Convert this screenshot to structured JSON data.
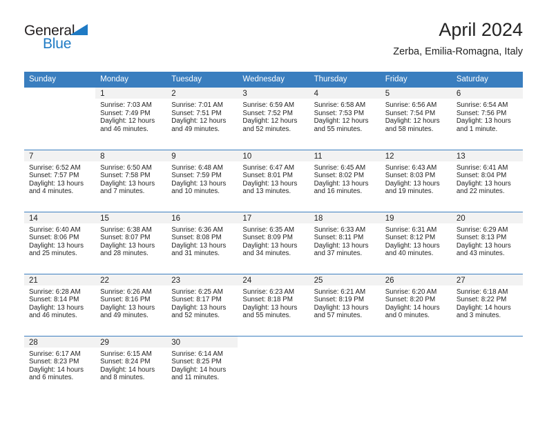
{
  "brand": {
    "name_top": "General",
    "name_bottom": "Blue",
    "triangle_icon": "triangle-icon",
    "accent_color": "#1e7ac4"
  },
  "header": {
    "title": "April 2024",
    "subtitle": "Zerba, Emilia-Romagna, Italy"
  },
  "calendar": {
    "header_bg": "#3a7ebf",
    "datebar_bg": "#f2f2f2",
    "weekday_headers": [
      "Sunday",
      "Monday",
      "Tuesday",
      "Wednesday",
      "Thursday",
      "Friday",
      "Saturday"
    ],
    "weeks": [
      [
        {
          "date": "",
          "lines": []
        },
        {
          "date": "1",
          "lines": [
            "Sunrise: 7:03 AM",
            "Sunset: 7:49 PM",
            "Daylight: 12 hours",
            "and 46 minutes."
          ]
        },
        {
          "date": "2",
          "lines": [
            "Sunrise: 7:01 AM",
            "Sunset: 7:51 PM",
            "Daylight: 12 hours",
            "and 49 minutes."
          ]
        },
        {
          "date": "3",
          "lines": [
            "Sunrise: 6:59 AM",
            "Sunset: 7:52 PM",
            "Daylight: 12 hours",
            "and 52 minutes."
          ]
        },
        {
          "date": "4",
          "lines": [
            "Sunrise: 6:58 AM",
            "Sunset: 7:53 PM",
            "Daylight: 12 hours",
            "and 55 minutes."
          ]
        },
        {
          "date": "5",
          "lines": [
            "Sunrise: 6:56 AM",
            "Sunset: 7:54 PM",
            "Daylight: 12 hours",
            "and 58 minutes."
          ]
        },
        {
          "date": "6",
          "lines": [
            "Sunrise: 6:54 AM",
            "Sunset: 7:56 PM",
            "Daylight: 13 hours",
            "and 1 minute."
          ]
        }
      ],
      [
        {
          "date": "7",
          "lines": [
            "Sunrise: 6:52 AM",
            "Sunset: 7:57 PM",
            "Daylight: 13 hours",
            "and 4 minutes."
          ]
        },
        {
          "date": "8",
          "lines": [
            "Sunrise: 6:50 AM",
            "Sunset: 7:58 PM",
            "Daylight: 13 hours",
            "and 7 minutes."
          ]
        },
        {
          "date": "9",
          "lines": [
            "Sunrise: 6:48 AM",
            "Sunset: 7:59 PM",
            "Daylight: 13 hours",
            "and 10 minutes."
          ]
        },
        {
          "date": "10",
          "lines": [
            "Sunrise: 6:47 AM",
            "Sunset: 8:01 PM",
            "Daylight: 13 hours",
            "and 13 minutes."
          ]
        },
        {
          "date": "11",
          "lines": [
            "Sunrise: 6:45 AM",
            "Sunset: 8:02 PM",
            "Daylight: 13 hours",
            "and 16 minutes."
          ]
        },
        {
          "date": "12",
          "lines": [
            "Sunrise: 6:43 AM",
            "Sunset: 8:03 PM",
            "Daylight: 13 hours",
            "and 19 minutes."
          ]
        },
        {
          "date": "13",
          "lines": [
            "Sunrise: 6:41 AM",
            "Sunset: 8:04 PM",
            "Daylight: 13 hours",
            "and 22 minutes."
          ]
        }
      ],
      [
        {
          "date": "14",
          "lines": [
            "Sunrise: 6:40 AM",
            "Sunset: 8:06 PM",
            "Daylight: 13 hours",
            "and 25 minutes."
          ]
        },
        {
          "date": "15",
          "lines": [
            "Sunrise: 6:38 AM",
            "Sunset: 8:07 PM",
            "Daylight: 13 hours",
            "and 28 minutes."
          ]
        },
        {
          "date": "16",
          "lines": [
            "Sunrise: 6:36 AM",
            "Sunset: 8:08 PM",
            "Daylight: 13 hours",
            "and 31 minutes."
          ]
        },
        {
          "date": "17",
          "lines": [
            "Sunrise: 6:35 AM",
            "Sunset: 8:09 PM",
            "Daylight: 13 hours",
            "and 34 minutes."
          ]
        },
        {
          "date": "18",
          "lines": [
            "Sunrise: 6:33 AM",
            "Sunset: 8:11 PM",
            "Daylight: 13 hours",
            "and 37 minutes."
          ]
        },
        {
          "date": "19",
          "lines": [
            "Sunrise: 6:31 AM",
            "Sunset: 8:12 PM",
            "Daylight: 13 hours",
            "and 40 minutes."
          ]
        },
        {
          "date": "20",
          "lines": [
            "Sunrise: 6:29 AM",
            "Sunset: 8:13 PM",
            "Daylight: 13 hours",
            "and 43 minutes."
          ]
        }
      ],
      [
        {
          "date": "21",
          "lines": [
            "Sunrise: 6:28 AM",
            "Sunset: 8:14 PM",
            "Daylight: 13 hours",
            "and 46 minutes."
          ]
        },
        {
          "date": "22",
          "lines": [
            "Sunrise: 6:26 AM",
            "Sunset: 8:16 PM",
            "Daylight: 13 hours",
            "and 49 minutes."
          ]
        },
        {
          "date": "23",
          "lines": [
            "Sunrise: 6:25 AM",
            "Sunset: 8:17 PM",
            "Daylight: 13 hours",
            "and 52 minutes."
          ]
        },
        {
          "date": "24",
          "lines": [
            "Sunrise: 6:23 AM",
            "Sunset: 8:18 PM",
            "Daylight: 13 hours",
            "and 55 minutes."
          ]
        },
        {
          "date": "25",
          "lines": [
            "Sunrise: 6:21 AM",
            "Sunset: 8:19 PM",
            "Daylight: 13 hours",
            "and 57 minutes."
          ]
        },
        {
          "date": "26",
          "lines": [
            "Sunrise: 6:20 AM",
            "Sunset: 8:20 PM",
            "Daylight: 14 hours",
            "and 0 minutes."
          ]
        },
        {
          "date": "27",
          "lines": [
            "Sunrise: 6:18 AM",
            "Sunset: 8:22 PM",
            "Daylight: 14 hours",
            "and 3 minutes."
          ]
        }
      ],
      [
        {
          "date": "28",
          "lines": [
            "Sunrise: 6:17 AM",
            "Sunset: 8:23 PM",
            "Daylight: 14 hours",
            "and 6 minutes."
          ]
        },
        {
          "date": "29",
          "lines": [
            "Sunrise: 6:15 AM",
            "Sunset: 8:24 PM",
            "Daylight: 14 hours",
            "and 8 minutes."
          ]
        },
        {
          "date": "30",
          "lines": [
            "Sunrise: 6:14 AM",
            "Sunset: 8:25 PM",
            "Daylight: 14 hours",
            "and 11 minutes."
          ]
        },
        {
          "date": "",
          "lines": []
        },
        {
          "date": "",
          "lines": []
        },
        {
          "date": "",
          "lines": []
        },
        {
          "date": "",
          "lines": []
        }
      ]
    ]
  }
}
